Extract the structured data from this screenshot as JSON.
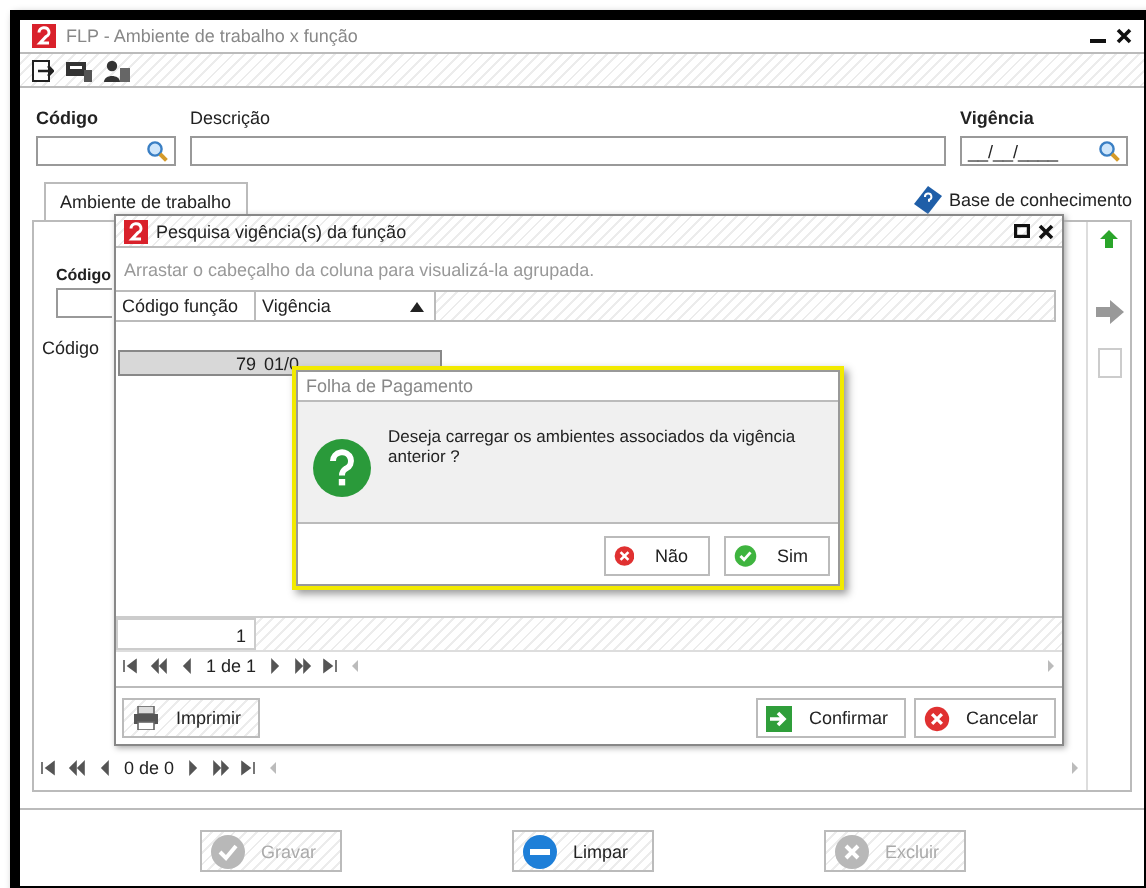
{
  "window": {
    "title": "FLP - Ambiente de trabalho x função"
  },
  "form": {
    "fields": [
      {
        "label": "Código",
        "required": true,
        "kind": "search"
      },
      {
        "label": "Descrição",
        "required": false,
        "kind": "text"
      },
      {
        "label": "Vigência",
        "required": true,
        "kind": "search",
        "value": "__/__/____"
      }
    ]
  },
  "tabs": [
    {
      "label": "Ambiente de trabalho",
      "selected": true
    }
  ],
  "help_link": "Base de conhecimento",
  "tab_panel": {
    "field_label": "Código",
    "column_header": "Código",
    "pager": "0 de 0"
  },
  "actions": [
    {
      "label": "Gravar",
      "kind": "save",
      "disabled": true
    },
    {
      "label": "Limpar",
      "kind": "clear",
      "disabled": false
    },
    {
      "label": "Excluir",
      "kind": "delete",
      "disabled": true
    }
  ],
  "search_dialog": {
    "title": "Pesquisa vigência(s) da função",
    "group_hint": "Arrastar o cabeçalho da coluna para visualizá-la agrupada.",
    "columns": [
      {
        "label": "Código função",
        "sorted": false
      },
      {
        "label": "Vigência",
        "sorted": true
      }
    ],
    "rows": [
      {
        "cells": [
          "79",
          "01/0"
        ],
        "selected": true
      }
    ],
    "count": "1",
    "pager": "1 de 1",
    "buttons": [
      {
        "label": "Imprimir",
        "kind": "print"
      },
      {
        "label": "Confirmar",
        "kind": "confirm"
      },
      {
        "label": "Cancelar",
        "kind": "cancel"
      }
    ]
  },
  "message_box": {
    "title": "Folha de Pagamento",
    "message": "Deseja carregar os ambientes associados da vigência anterior ?",
    "buttons": [
      {
        "label": "Não",
        "kind": "no"
      },
      {
        "label": "Sim",
        "kind": "yes"
      }
    ]
  }
}
